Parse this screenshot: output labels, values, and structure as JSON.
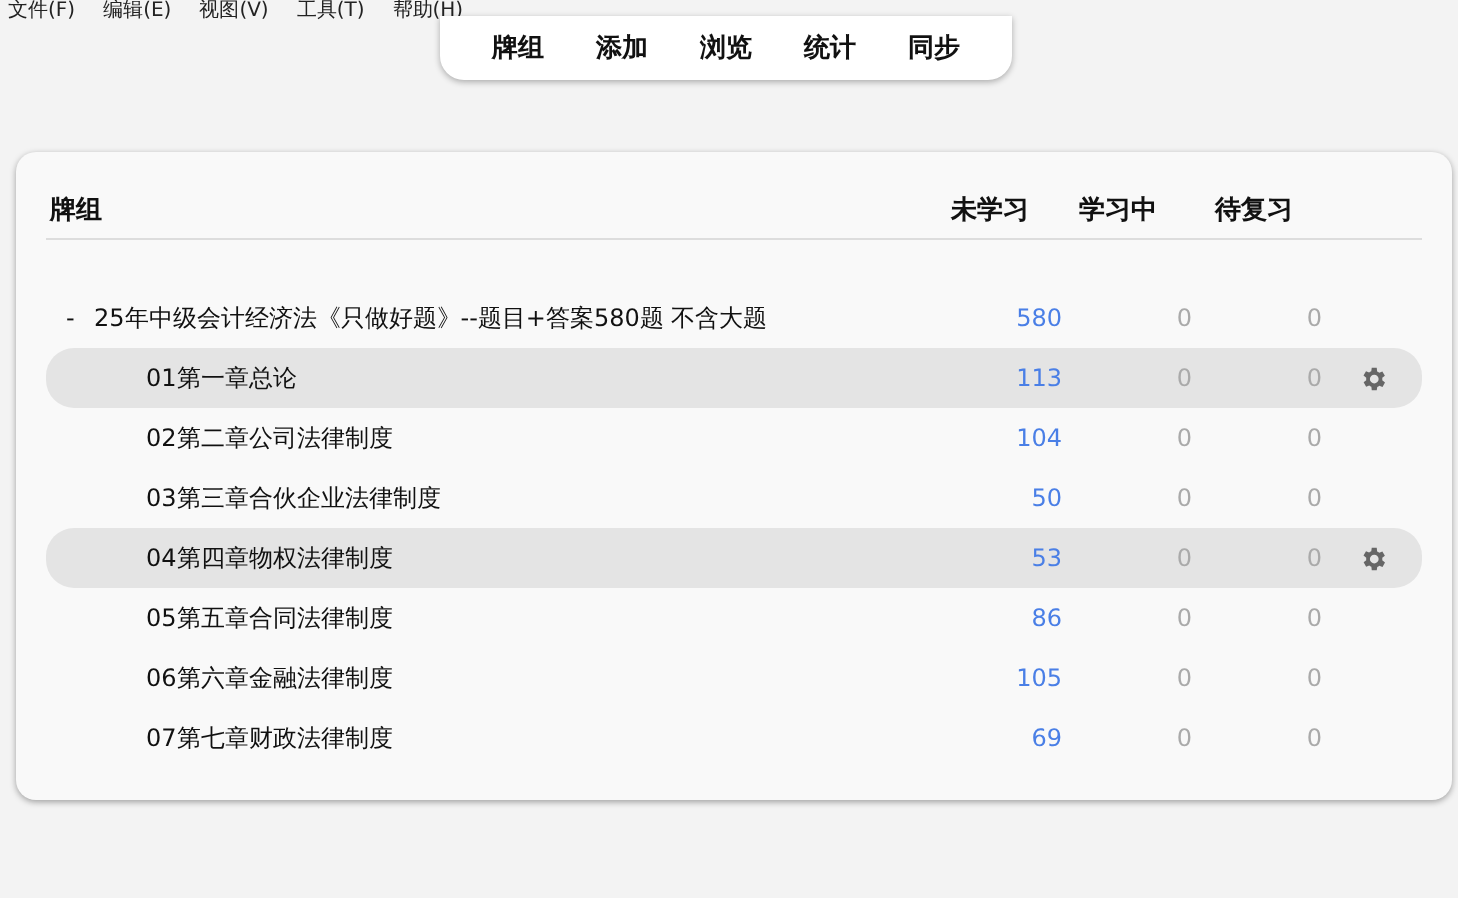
{
  "menu_bar": [
    "文件(F)",
    "编辑(E)",
    "视图(V)",
    "工具(T)",
    "帮助(H)"
  ],
  "toolbar": [
    "牌组",
    "添加",
    "浏览",
    "统计",
    "同步"
  ],
  "deck_table": {
    "columns": [
      "牌组",
      "未学习",
      "学习中",
      "待复习"
    ],
    "decks": [
      {
        "toggle": "-",
        "name": "25年中级会计经济法《只做好题》--题目+答案580题 不含大题",
        "new": "580",
        "learning": "0",
        "review": "0",
        "highlighted": false,
        "expanded": true,
        "children": [
          {
            "name": "01第一章总论",
            "new": "113",
            "learning": "0",
            "review": "0",
            "highlighted": true
          },
          {
            "name": "02第二章公司法律制度",
            "new": "104",
            "learning": "0",
            "review": "0",
            "highlighted": false
          },
          {
            "name": "03第三章合伙企业法律制度",
            "new": "50",
            "learning": "0",
            "review": "0",
            "highlighted": false
          },
          {
            "name": "04第四章物权法律制度",
            "new": "53",
            "learning": "0",
            "review": "0",
            "highlighted": true
          },
          {
            "name": "05第五章合同法律制度",
            "new": "86",
            "learning": "0",
            "review": "0",
            "highlighted": false
          },
          {
            "name": "06第六章金融法律制度",
            "new": "105",
            "learning": "0",
            "review": "0",
            "highlighted": false
          },
          {
            "name": "07第七章财政法律制度",
            "new": "69",
            "learning": "0",
            "review": "0",
            "highlighted": false
          }
        ]
      }
    ]
  }
}
